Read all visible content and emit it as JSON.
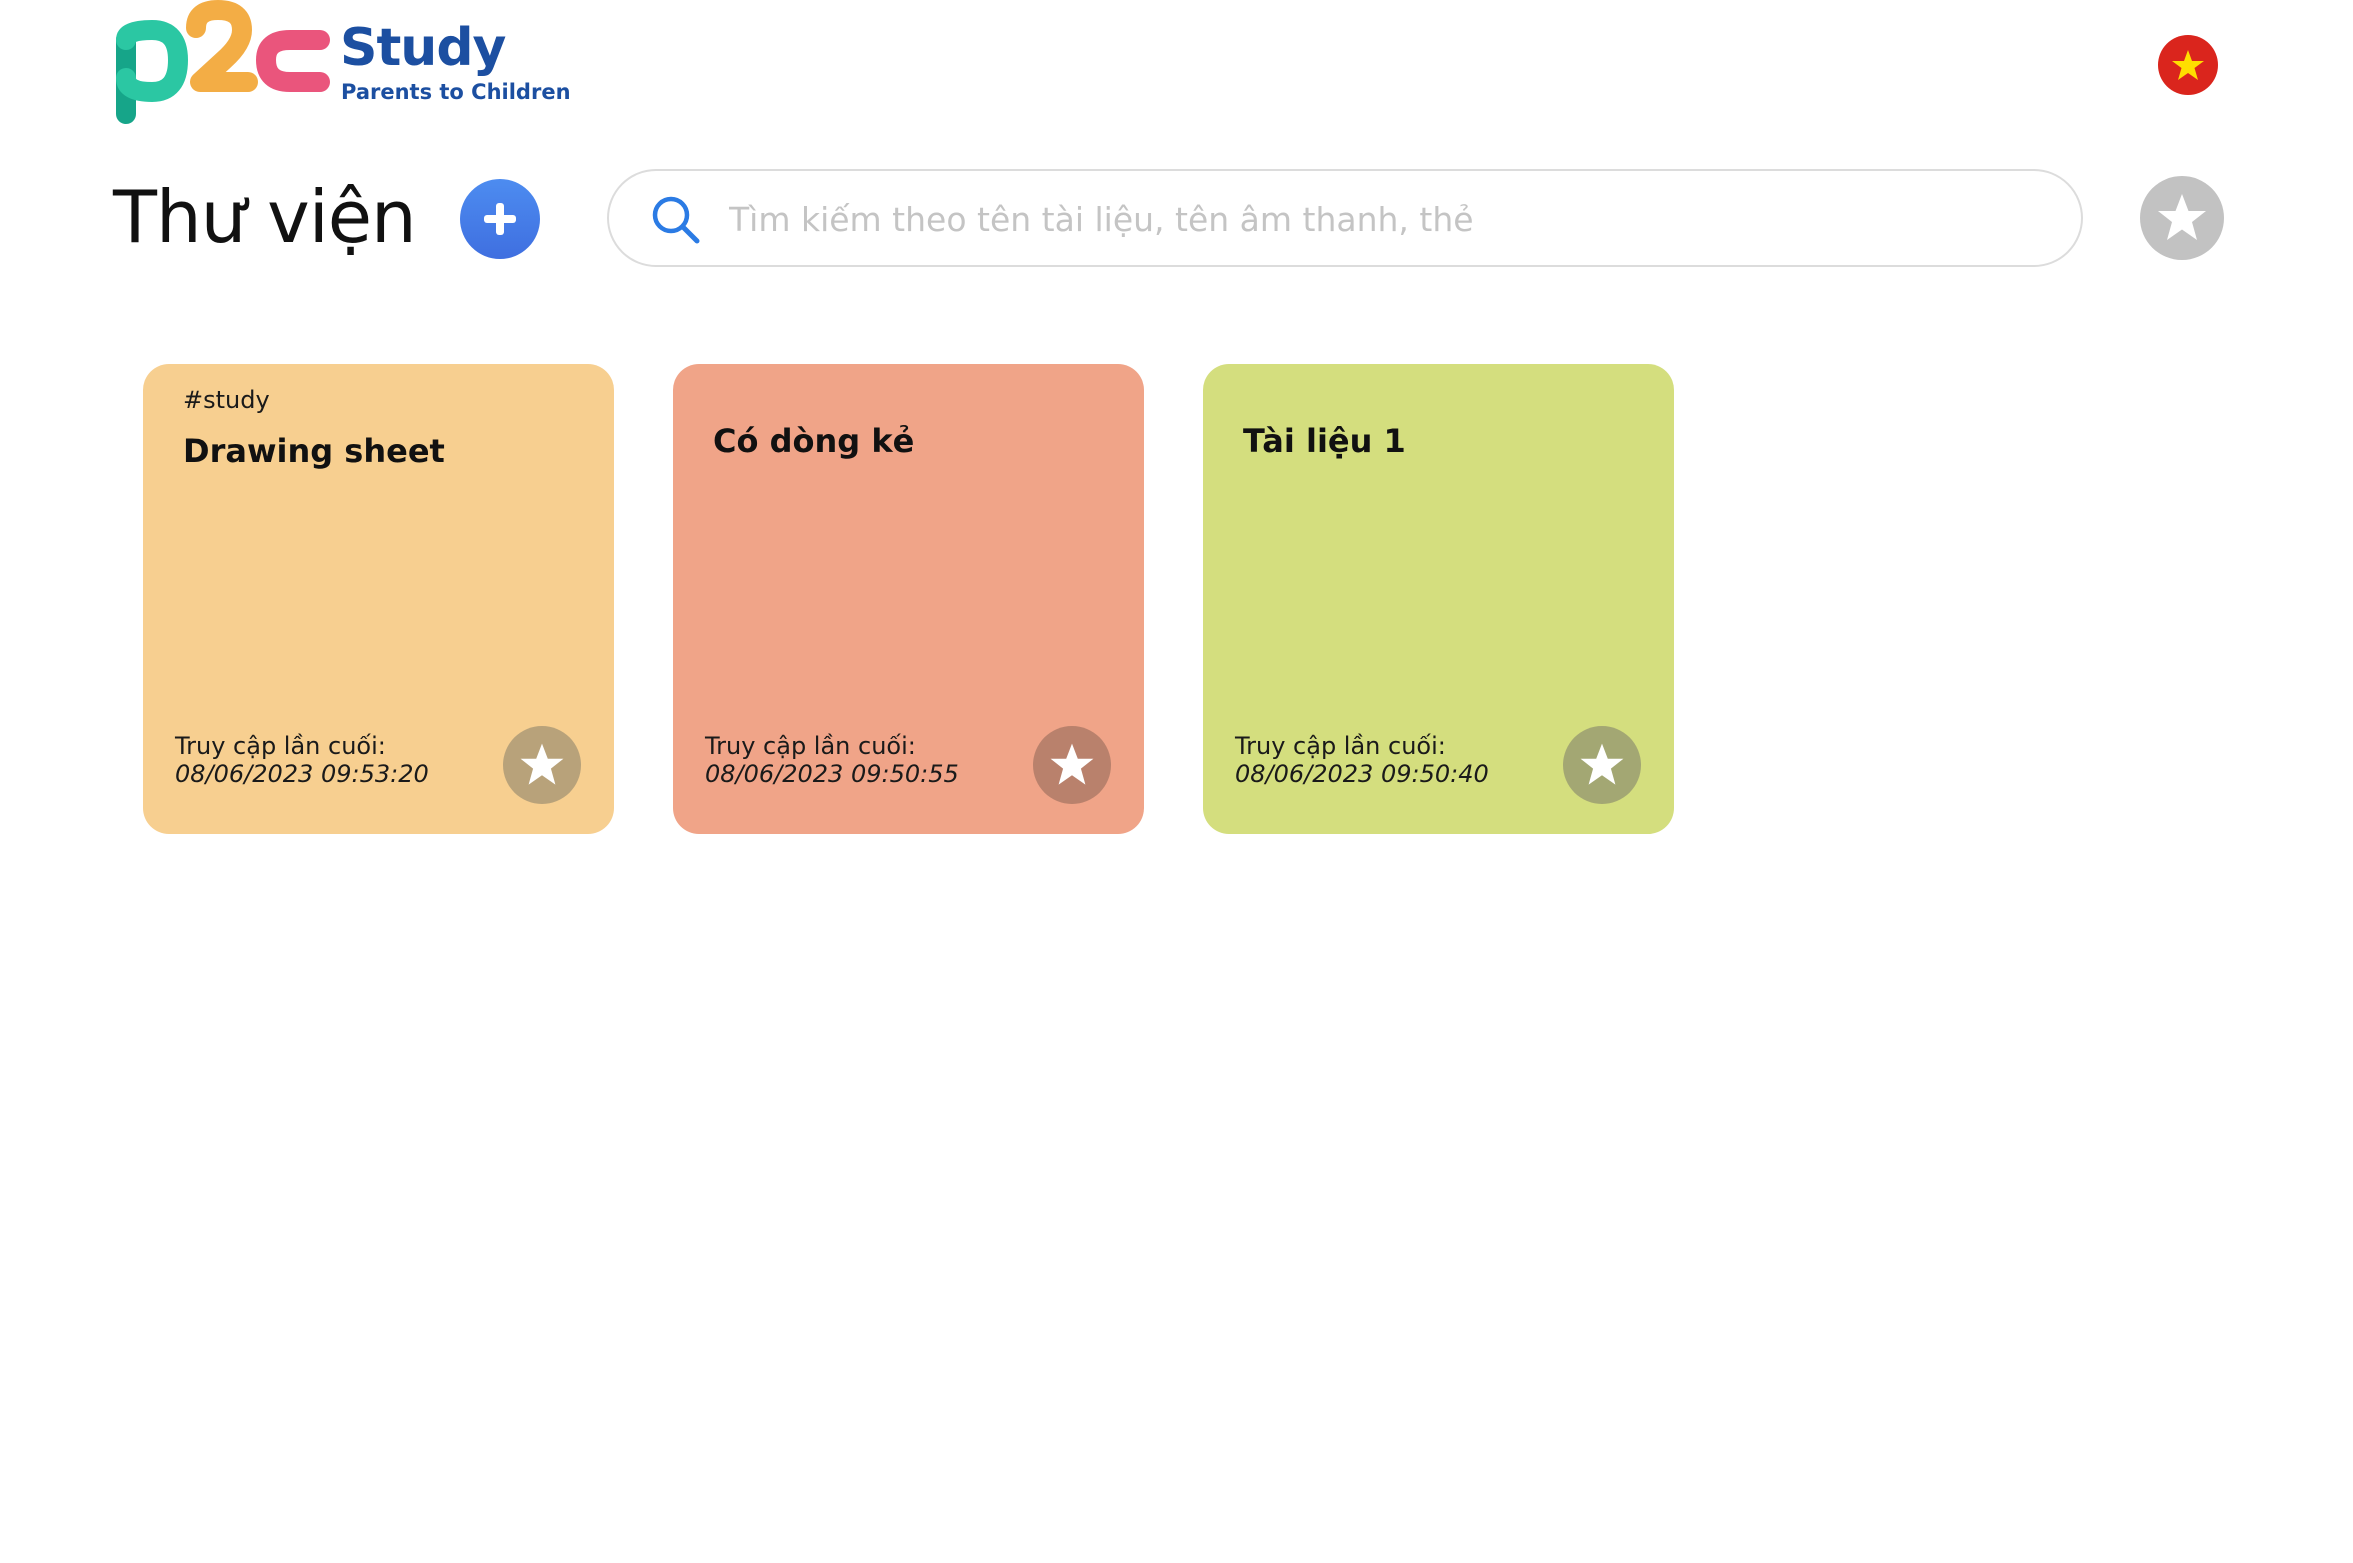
{
  "brand": {
    "logo_mark": "p2c",
    "name": "Study",
    "tagline": "Parents to Children"
  },
  "header": {
    "language_icon": "vietnam-flag-icon"
  },
  "toolbar": {
    "title": "Thư viện",
    "add_icon": "plus-icon",
    "search_placeholder": "Tìm kiếm theo tên tài liệu, tên âm thanh, thẻ",
    "search_value": "",
    "favorite_filter_icon": "star-icon"
  },
  "colors": {
    "brand_blue": "#1c4fa1",
    "add_button": "#4a80ec",
    "flag_red": "#da251d",
    "flag_star": "#ffde00"
  },
  "cards": [
    {
      "tag": "#study",
      "title": "Drawing sheet",
      "access_label": "Truy cập lần cuối:",
      "access_time": "08/06/2023 09:53:20",
      "bg_color": "#f7cf90",
      "star_bg": "#b8a27a"
    },
    {
      "tag": "",
      "title": "Có dòng kẻ",
      "access_label": "Truy cập lần cuối:",
      "access_time": "08/06/2023 09:50:55",
      "bg_color": "#f0a488",
      "star_bg": "#b9816c"
    },
    {
      "tag": "",
      "title": "Tài liệu 1",
      "access_label": "Truy cập lần cuối:",
      "access_time": "08/06/2023 09:50:40",
      "bg_color": "#d4de7e",
      "star_bg": "#a3a773"
    }
  ]
}
